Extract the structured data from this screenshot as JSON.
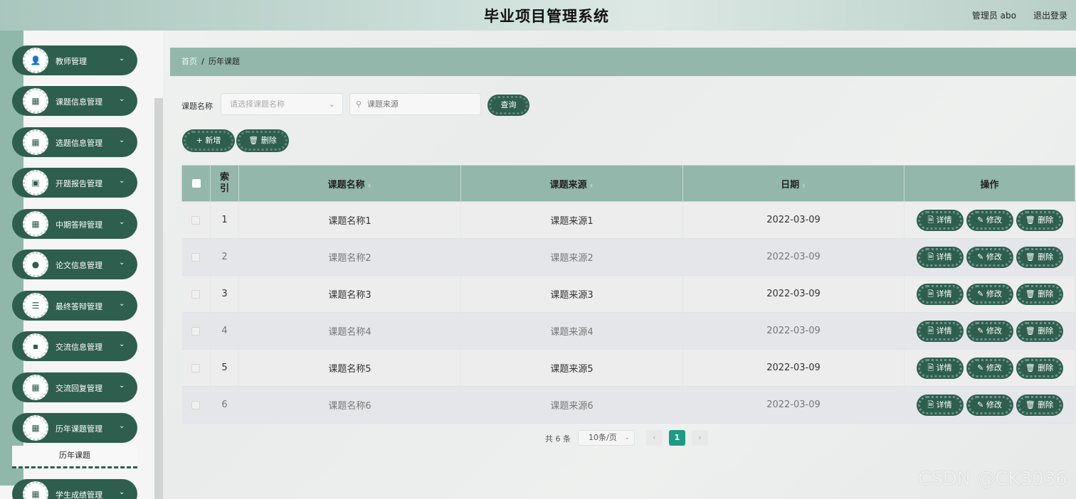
{
  "header": {
    "title": "毕业项目管理系统",
    "user": "管理员 abo",
    "logout": "退出登录"
  },
  "sidebar": {
    "items": [
      {
        "label": "教师管理",
        "icon": "user-icon",
        "glyph": "👤"
      },
      {
        "label": "课题信息管理",
        "icon": "grid-icon",
        "glyph": "▦"
      },
      {
        "label": "选题信息管理",
        "icon": "grid-icon",
        "glyph": "▦"
      },
      {
        "label": "开题报告管理",
        "icon": "chart-icon",
        "glyph": "▣"
      },
      {
        "label": "中期答辩管理",
        "icon": "grid-icon",
        "glyph": "▦"
      },
      {
        "label": "论文信息管理",
        "icon": "location-icon",
        "glyph": "●"
      },
      {
        "label": "最终答辩管理",
        "icon": "sliders-icon",
        "glyph": "☰"
      },
      {
        "label": "交流信息管理",
        "icon": "wallet-icon",
        "glyph": "▪"
      },
      {
        "label": "交流回复管理",
        "icon": "grid-icon",
        "glyph": "▦"
      },
      {
        "label": "历年课题管理",
        "icon": "grid-icon",
        "glyph": "▦"
      },
      {
        "label": "学生成绩管理",
        "icon": "grid-icon",
        "glyph": "▦"
      }
    ],
    "sub_item": "历年课题",
    "chevron": "⌄"
  },
  "breadcrumb": {
    "home": "首页",
    "sep": "/",
    "current": "历年课题"
  },
  "search": {
    "label": "课题名称",
    "select_placeholder": "请选择课题名称",
    "input_placeholder": "课题来源",
    "query_button": "查询"
  },
  "toolbar": {
    "add_label": "+ 新增",
    "delete_label": "🗑 删除"
  },
  "table": {
    "columns": [
      "索引",
      "课题名称",
      "课题来源",
      "日期",
      "操作"
    ],
    "rows": [
      {
        "index": "1",
        "name": "课题名称1",
        "source": "课题来源1",
        "date": "2022-03-09"
      },
      {
        "index": "2",
        "name": "课题名称2",
        "source": "课题来源2",
        "date": "2022-03-09"
      },
      {
        "index": "3",
        "name": "课题名称3",
        "source": "课题来源3",
        "date": "2022-03-09"
      },
      {
        "index": "4",
        "name": "课题名称4",
        "source": "课题来源4",
        "date": "2022-03-09"
      },
      {
        "index": "5",
        "name": "课题名称5",
        "source": "课题来源5",
        "date": "2022-03-09"
      },
      {
        "index": "6",
        "name": "课题名称6",
        "source": "课题来源6",
        "date": "2022-03-09"
      }
    ],
    "actions": {
      "detail": "详情",
      "edit": "修改",
      "delete": "删除"
    }
  },
  "pagination": {
    "total": "共 6 条",
    "page_size": "10条/页",
    "current": "1",
    "prev": "‹",
    "next": "›"
  },
  "watermark": "CSDN @CK3036",
  "colors": {
    "primary": "#2e5e4e",
    "accent": "#93b7aa",
    "active_page": "#1d9a84"
  }
}
